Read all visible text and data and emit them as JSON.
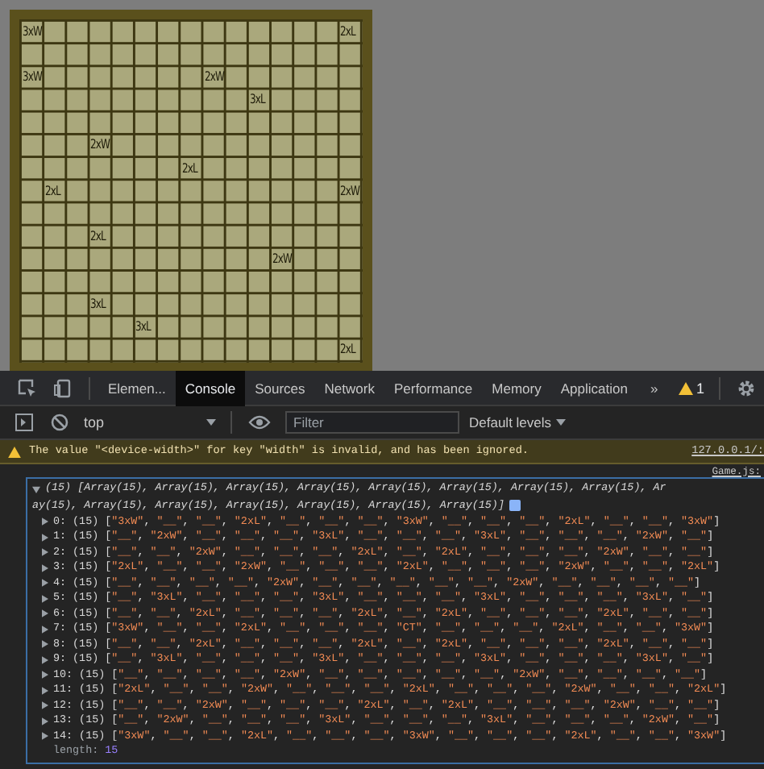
{
  "board": {
    "rows": [
      [
        "3xW",
        null,
        null,
        null,
        null,
        null,
        null,
        null,
        null,
        null,
        null,
        null,
        null,
        null,
        "2xL"
      ],
      [
        null,
        null,
        null,
        null,
        null,
        null,
        null,
        null,
        null,
        null,
        null,
        null,
        null,
        null,
        null
      ],
      [
        "3xW",
        null,
        null,
        null,
        null,
        null,
        null,
        null,
        "2xW",
        null,
        null,
        null,
        null,
        null,
        null
      ],
      [
        null,
        null,
        null,
        null,
        null,
        null,
        null,
        null,
        null,
        null,
        "3xL",
        null,
        null,
        null,
        null
      ],
      [
        null,
        null,
        null,
        null,
        null,
        null,
        null,
        null,
        null,
        null,
        null,
        null,
        null,
        null,
        null
      ],
      [
        null,
        null,
        null,
        "2xW",
        null,
        null,
        null,
        null,
        null,
        null,
        null,
        null,
        null,
        null,
        null
      ],
      [
        null,
        null,
        null,
        null,
        null,
        null,
        null,
        "2xL",
        null,
        null,
        null,
        null,
        null,
        null,
        null
      ],
      [
        null,
        "2xL",
        null,
        null,
        null,
        null,
        null,
        null,
        null,
        null,
        null,
        null,
        null,
        null,
        "2xW"
      ],
      [
        null,
        null,
        null,
        null,
        null,
        null,
        null,
        null,
        null,
        null,
        null,
        null,
        null,
        null,
        null
      ],
      [
        null,
        null,
        null,
        "2xL",
        null,
        null,
        null,
        null,
        null,
        null,
        null,
        null,
        null,
        null,
        null
      ],
      [
        null,
        null,
        null,
        null,
        null,
        null,
        null,
        null,
        null,
        null,
        null,
        "2xW",
        null,
        null,
        null
      ],
      [
        null,
        null,
        null,
        null,
        null,
        null,
        null,
        null,
        null,
        null,
        null,
        null,
        null,
        null,
        null
      ],
      [
        null,
        null,
        null,
        "3xL",
        null,
        null,
        null,
        null,
        null,
        null,
        null,
        null,
        null,
        null,
        null
      ],
      [
        null,
        null,
        null,
        null,
        null,
        "3xL",
        null,
        null,
        null,
        null,
        null,
        null,
        null,
        null,
        null
      ],
      [
        null,
        null,
        null,
        null,
        null,
        null,
        null,
        null,
        null,
        null,
        null,
        null,
        null,
        null,
        "2xL"
      ]
    ]
  },
  "devtools": {
    "tabs": [
      {
        "label": "Elemen...",
        "selected": false
      },
      {
        "label": "Console",
        "selected": true
      },
      {
        "label": "Sources",
        "selected": false
      },
      {
        "label": "Network",
        "selected": false
      },
      {
        "label": "Performance",
        "selected": false
      },
      {
        "label": "Memory",
        "selected": false
      },
      {
        "label": "Application",
        "selected": false
      }
    ],
    "more": "»",
    "warning_count": "1",
    "context": "top",
    "filter_placeholder": "Filter",
    "levels": "Default levels",
    "warning": {
      "message": "The value \"<device-width>\" for key \"width\" is invalid, and has been ignored.",
      "source": "127.0.0.1/:"
    },
    "log_source": "Game.js:",
    "log": {
      "header": [
        "(15) [Array(15), Array(15), Array(15), Array(15), Array(15), Array(15), Array(15), Array(15), Ar",
        "ay(15), Array(15), Array(15), Array(15), Array(15), Array(15), Array(15)]"
      ],
      "separator": ", ",
      "close": "]",
      "rows": [
        {
          "prefix": "0: (15) [",
          "values": [
            "\"3xW\"",
            "\"__\"",
            "\"__\"",
            "\"2xL\"",
            "\"__\"",
            "\"__\"",
            "\"__\"",
            "\"3xW\"",
            "\"__\"",
            "\"__\"",
            "\"__\"",
            "\"2xL\"",
            "\"__\"",
            "\"__\"",
            "\"3xW\""
          ]
        },
        {
          "prefix": "1: (15) [",
          "values": [
            "\"__\"",
            "\"2xW\"",
            "\"__\"",
            "\"__\"",
            "\"__\"",
            "\"3xL\"",
            "\"__\"",
            "\"__\"",
            "\"__\"",
            "\"3xL\"",
            "\"__\"",
            "\"__\"",
            "\"__\"",
            "\"2xW\"",
            "\"__\""
          ]
        },
        {
          "prefix": "2: (15) [",
          "values": [
            "\"__\"",
            "\"__\"",
            "\"2xW\"",
            "\"__\"",
            "\"__\"",
            "\"__\"",
            "\"2xL\"",
            "\"__\"",
            "\"2xL\"",
            "\"__\"",
            "\"__\"",
            "\"__\"",
            "\"2xW\"",
            "\"__\"",
            "\"__\""
          ]
        },
        {
          "prefix": "3: (15) [",
          "values": [
            "\"2xL\"",
            "\"__\"",
            "\"__\"",
            "\"2xW\"",
            "\"__\"",
            "\"__\"",
            "\"__\"",
            "\"2xL\"",
            "\"__\"",
            "\"__\"",
            "\"__\"",
            "\"2xW\"",
            "\"__\"",
            "\"__\"",
            "\"2xL\""
          ]
        },
        {
          "prefix": "4: (15) [",
          "values": [
            "\"__\"",
            "\"__\"",
            "\"__\"",
            "\"__\"",
            "\"2xW\"",
            "\"__\"",
            "\"__\"",
            "\"__\"",
            "\"__\"",
            "\"__\"",
            "\"2xW\"",
            "\"__\"",
            "\"__\"",
            "\"__\"",
            "\"__\""
          ]
        },
        {
          "prefix": "5: (15) [",
          "values": [
            "\"__\"",
            "\"3xL\"",
            "\"__\"",
            "\"__\"",
            "\"__\"",
            "\"3xL\"",
            "\"__\"",
            "\"__\"",
            "\"__\"",
            "\"3xL\"",
            "\"__\"",
            "\"__\"",
            "\"__\"",
            "\"3xL\"",
            "\"__\""
          ]
        },
        {
          "prefix": "6: (15) [",
          "values": [
            "\"__\"",
            "\"__\"",
            "\"2xL\"",
            "\"__\"",
            "\"__\"",
            "\"__\"",
            "\"2xL\"",
            "\"__\"",
            "\"2xL\"",
            "\"__\"",
            "\"__\"",
            "\"__\"",
            "\"2xL\"",
            "\"__\"",
            "\"__\""
          ]
        },
        {
          "prefix": "7: (15) [",
          "values": [
            "\"3xW\"",
            "\"__\"",
            "\"__\"",
            "\"2xL\"",
            "\"__\"",
            "\"__\"",
            "\"__\"",
            "\"CT\"",
            "\"__\"",
            "\"__\"",
            "\"__\"",
            "\"2xL\"",
            "\"__\"",
            "\"__\"",
            "\"3xW\""
          ]
        },
        {
          "prefix": "8: (15) [",
          "values": [
            "\"__\"",
            "\"__\"",
            "\"2xL\"",
            "\"__\"",
            "\"__\"",
            "\"__\"",
            "\"2xL\"",
            "\"__\"",
            "\"2xL\"",
            "\"__\"",
            "\"__\"",
            "\"__\"",
            "\"2xL\"",
            "\"__\"",
            "\"__\""
          ]
        },
        {
          "prefix": "9: (15) [",
          "values": [
            "\"__\"",
            "\"3xL\"",
            "\"__\"",
            "\"__\"",
            "\"__\"",
            "\"3xL\"",
            "\"__\"",
            "\"__\"",
            "\"__\"",
            "\"3xL\"",
            "\"__\"",
            "\"__\"",
            "\"__\"",
            "\"3xL\"",
            "\"__\""
          ]
        },
        {
          "prefix": "10: (15) [",
          "values": [
            "\"__\"",
            "\"__\"",
            "\"__\"",
            "\"__\"",
            "\"2xW\"",
            "\"__\"",
            "\"__\"",
            "\"__\"",
            "\"__\"",
            "\"__\"",
            "\"2xW\"",
            "\"__\"",
            "\"__\"",
            "\"__\"",
            "\"__\""
          ]
        },
        {
          "prefix": "11: (15) [",
          "values": [
            "\"2xL\"",
            "\"__\"",
            "\"__\"",
            "\"2xW\"",
            "\"__\"",
            "\"__\"",
            "\"__\"",
            "\"2xL\"",
            "\"__\"",
            "\"__\"",
            "\"__\"",
            "\"2xW\"",
            "\"__\"",
            "\"__\"",
            "\"2xL\""
          ]
        },
        {
          "prefix": "12: (15) [",
          "values": [
            "\"__\"",
            "\"__\"",
            "\"2xW\"",
            "\"__\"",
            "\"__\"",
            "\"__\"",
            "\"2xL\"",
            "\"__\"",
            "\"2xL\"",
            "\"__\"",
            "\"__\"",
            "\"__\"",
            "\"2xW\"",
            "\"__\"",
            "\"__\""
          ]
        },
        {
          "prefix": "13: (15) [",
          "values": [
            "\"__\"",
            "\"2xW\"",
            "\"__\"",
            "\"__\"",
            "\"__\"",
            "\"3xL\"",
            "\"__\"",
            "\"__\"",
            "\"__\"",
            "\"3xL\"",
            "\"__\"",
            "\"__\"",
            "\"__\"",
            "\"2xW\"",
            "\"__\""
          ]
        },
        {
          "prefix": "14: (15) [",
          "values": [
            "\"3xW\"",
            "\"__\"",
            "\"__\"",
            "\"2xL\"",
            "\"__\"",
            "\"__\"",
            "\"__\"",
            "\"3xW\"",
            "\"__\"",
            "\"__\"",
            "\"__\"",
            "\"2xL\"",
            "\"__\"",
            "\"__\"",
            "\"3xW\""
          ]
        }
      ],
      "length_key": "length:",
      "length_value": "15"
    }
  }
}
